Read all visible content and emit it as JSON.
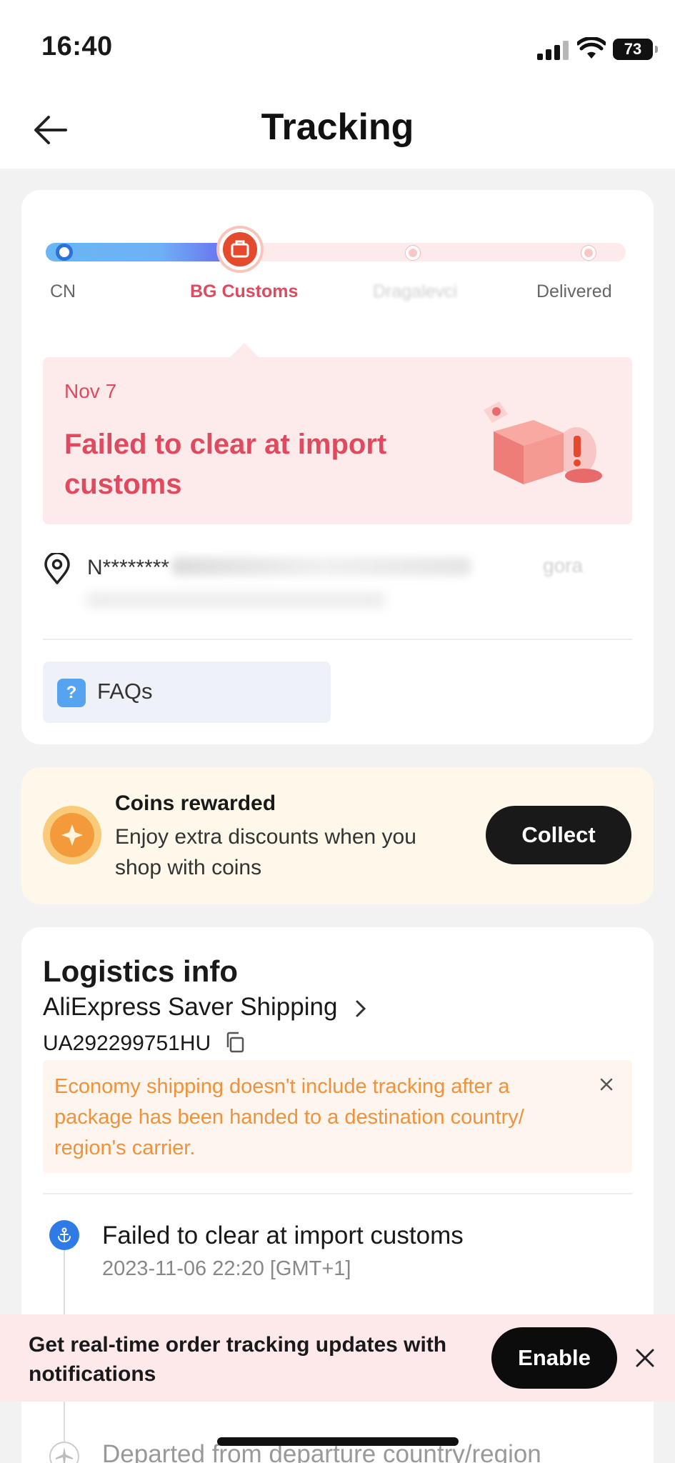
{
  "status_bar": {
    "time": "16:40",
    "battery": "73"
  },
  "header": {
    "title": "Tracking"
  },
  "progress": {
    "steps": [
      {
        "label": "CN"
      },
      {
        "label": "BG Customs"
      },
      {
        "label": "Dragalevci"
      },
      {
        "label": "Delivered"
      }
    ],
    "current_step_index": 1,
    "fill_fraction": 0.36
  },
  "status": {
    "date": "Nov 7",
    "title": "Failed to clear at import customs"
  },
  "address": {
    "visible_start": "N********",
    "visible_tail": "gora"
  },
  "faq": {
    "label": "FAQs",
    "icon": "?"
  },
  "coins": {
    "title": "Coins rewarded",
    "description": "Enjoy extra discounts when you shop with coins",
    "button": "Collect"
  },
  "logistics": {
    "title": "Logistics info",
    "carrier": "AliExpress Saver Shipping",
    "tracking_number": "UA292299751HU",
    "notice": "Economy shipping doesn't include tracking after a package has been handed to a destination country/ region's carrier.",
    "events": [
      {
        "title": "Failed to clear at import customs",
        "time": "2023-11-06 22:20 [GMT+1]"
      },
      {
        "title": "Departed from departure country/region",
        "time": ""
      }
    ]
  },
  "notification": {
    "text": "Get real-time order tracking updates with notifications",
    "button": "Enable"
  },
  "colors": {
    "accent_red": "#e04a5e",
    "progress_blue": "#69b6f2",
    "notice_orange": "#f0913b",
    "dark_button": "#191919"
  }
}
